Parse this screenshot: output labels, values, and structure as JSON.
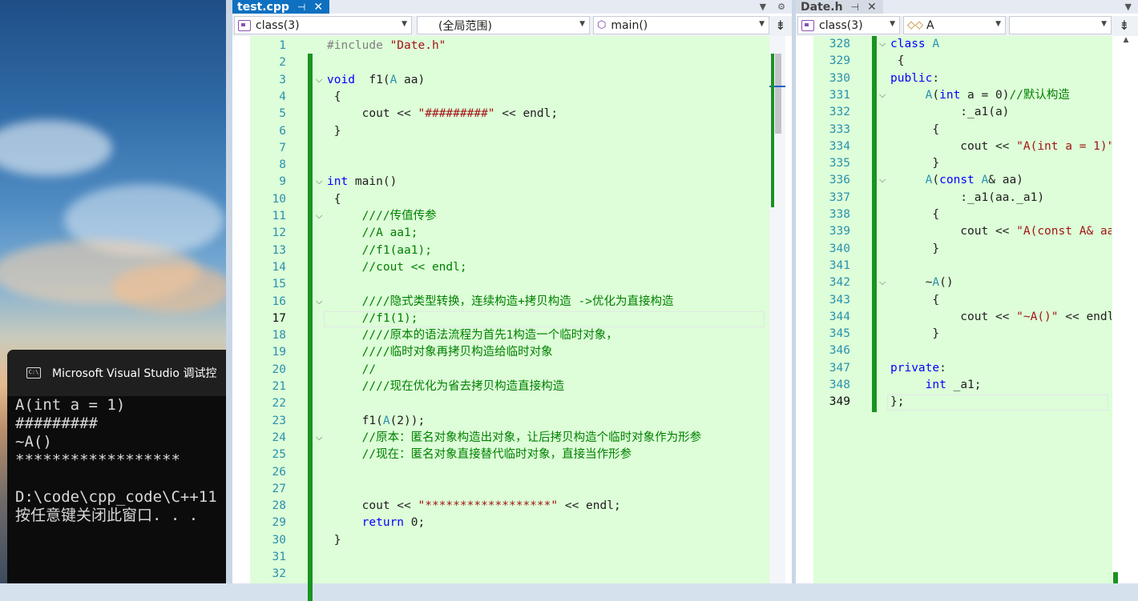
{
  "console": {
    "title": "Microsoft Visual Studio 调试控",
    "lines": [
      "A(int a = 1)",
      "#########",
      "~A()",
      "******************",
      "",
      "D:\\code\\cpp_code\\C++11",
      "按任意键关闭此窗口. . ."
    ]
  },
  "left_editor": {
    "tab": {
      "label": "test.cpp",
      "pin": "⊣",
      "close": "✕"
    },
    "nav": {
      "scope": "class(3)",
      "context": "(全局范围)",
      "member": "main()"
    },
    "lines": [
      {
        "n": "1",
        "t": [
          [
            "pp",
            "#include "
          ],
          [
            "st",
            "\"Date.h\""
          ]
        ]
      },
      {
        "n": "2",
        "t": []
      },
      {
        "n": "3",
        "t": [
          [
            "kw",
            "void"
          ],
          [
            "",
            "  "
          ],
          [
            "",
            "f1"
          ],
          [
            "",
            "("
          ],
          [
            "ty",
            "A"
          ],
          [
            "",
            " aa)"
          ]
        ]
      },
      {
        "n": "4",
        "t": [
          [
            "",
            " {"
          ]
        ]
      },
      {
        "n": "5",
        "t": [
          [
            "",
            "     cout << "
          ],
          [
            "st",
            "\"#########\""
          ],
          [
            "",
            " << endl;"
          ]
        ]
      },
      {
        "n": "6",
        "t": [
          [
            "",
            " }"
          ]
        ]
      },
      {
        "n": "7",
        "t": []
      },
      {
        "n": "8",
        "t": []
      },
      {
        "n": "9",
        "t": [
          [
            "kw",
            "int"
          ],
          [
            "",
            " main()"
          ]
        ]
      },
      {
        "n": "10",
        "t": [
          [
            "",
            " {"
          ]
        ]
      },
      {
        "n": "11",
        "t": [
          [
            "cm",
            "     ////传值传参"
          ]
        ]
      },
      {
        "n": "12",
        "t": [
          [
            "cm",
            "     //A aa1;"
          ]
        ]
      },
      {
        "n": "13",
        "t": [
          [
            "cm",
            "     //f1(aa1);"
          ]
        ]
      },
      {
        "n": "14",
        "t": [
          [
            "cm",
            "     //cout << endl;"
          ]
        ]
      },
      {
        "n": "15",
        "t": []
      },
      {
        "n": "16",
        "t": [
          [
            "cm",
            "     ////隐式类型转换，连续构造+拷贝构造 ->优化为直接构造"
          ]
        ]
      },
      {
        "n": "17",
        "t": [
          [
            "cm",
            "     //f1(1);"
          ]
        ]
      },
      {
        "n": "18",
        "t": [
          [
            "cm",
            "     ////原本的语法流程为首先1构造一个临时对象，"
          ]
        ]
      },
      {
        "n": "19",
        "t": [
          [
            "cm",
            "     ////临时对象再拷贝构造给临时对象"
          ]
        ]
      },
      {
        "n": "20",
        "t": [
          [
            "cm",
            "     //"
          ]
        ]
      },
      {
        "n": "21",
        "t": [
          [
            "cm",
            "     ////现在优化为省去拷贝构造直接构造"
          ]
        ]
      },
      {
        "n": "22",
        "t": []
      },
      {
        "n": "23",
        "t": [
          [
            "",
            "     f1("
          ],
          [
            "ty",
            "A"
          ],
          [
            "",
            "(2));"
          ]
        ]
      },
      {
        "n": "24",
        "t": [
          [
            "cm",
            "     //原本：匿名对象构造出对象，让后拷贝构造个临时对象作为形参"
          ]
        ]
      },
      {
        "n": "25",
        "t": [
          [
            "cm",
            "     //现在：匿名对象直接替代临时对象，直接当作形参"
          ]
        ]
      },
      {
        "n": "26",
        "t": []
      },
      {
        "n": "27",
        "t": []
      },
      {
        "n": "28",
        "t": [
          [
            "",
            "     cout << "
          ],
          [
            "st",
            "\"******************\""
          ],
          [
            "",
            " << endl;"
          ]
        ]
      },
      {
        "n": "29",
        "t": [
          [
            "",
            "     "
          ],
          [
            "kw",
            "return"
          ],
          [
            "",
            " 0;"
          ]
        ]
      },
      {
        "n": "30",
        "t": [
          [
            "",
            " }"
          ]
        ]
      },
      {
        "n": "31",
        "t": []
      },
      {
        "n": "32",
        "t": []
      }
    ],
    "current_line": "17"
  },
  "right_editor": {
    "tab": {
      "label": "Date.h",
      "pin": "⊣",
      "close": "✕"
    },
    "nav": {
      "scope": "class(3)",
      "member": "A"
    },
    "lines": [
      {
        "n": "328",
        "t": [
          [
            "kw",
            "class"
          ],
          [
            "",
            " "
          ],
          [
            "ty",
            "A"
          ]
        ]
      },
      {
        "n": "329",
        "t": [
          [
            "",
            " {"
          ]
        ]
      },
      {
        "n": "330",
        "t": [
          [
            "kw",
            "public"
          ],
          [
            "",
            ":"
          ]
        ]
      },
      {
        "n": "331",
        "t": [
          [
            "",
            "     "
          ],
          [
            "ty",
            "A"
          ],
          [
            "",
            "("
          ],
          [
            "kw",
            "int"
          ],
          [
            "",
            " a = 0)"
          ],
          [
            "cm",
            "//默认构造"
          ]
        ]
      },
      {
        "n": "332",
        "t": [
          [
            "",
            "          :_a1(a)"
          ]
        ]
      },
      {
        "n": "333",
        "t": [
          [
            "",
            "      {"
          ]
        ]
      },
      {
        "n": "334",
        "t": [
          [
            "",
            "          cout << "
          ],
          [
            "st",
            "\"A(int a = 1)\""
          ],
          [
            "",
            " <"
          ]
        ]
      },
      {
        "n": "335",
        "t": [
          [
            "",
            "      }"
          ]
        ]
      },
      {
        "n": "336",
        "t": [
          [
            "",
            "     "
          ],
          [
            "ty",
            "A"
          ],
          [
            "",
            "("
          ],
          [
            "kw",
            "const"
          ],
          [
            "",
            " "
          ],
          [
            "ty",
            "A"
          ],
          [
            "",
            "& aa)"
          ]
        ]
      },
      {
        "n": "337",
        "t": [
          [
            "",
            "          :_a1(aa._a1)"
          ]
        ]
      },
      {
        "n": "338",
        "t": [
          [
            "",
            "      {"
          ]
        ]
      },
      {
        "n": "339",
        "t": [
          [
            "",
            "          cout << "
          ],
          [
            "st",
            "\"A(const A& aa)\""
          ]
        ]
      },
      {
        "n": "340",
        "t": [
          [
            "",
            "      }"
          ]
        ]
      },
      {
        "n": "341",
        "t": []
      },
      {
        "n": "342",
        "t": [
          [
            "",
            "     ~"
          ],
          [
            "ty",
            "A"
          ],
          [
            "",
            "()"
          ]
        ]
      },
      {
        "n": "343",
        "t": [
          [
            "",
            "      {"
          ]
        ]
      },
      {
        "n": "344",
        "t": [
          [
            "",
            "          cout << "
          ],
          [
            "st",
            "\"~A()\""
          ],
          [
            "",
            " << endl;"
          ]
        ]
      },
      {
        "n": "345",
        "t": [
          [
            "",
            "      }"
          ]
        ]
      },
      {
        "n": "346",
        "t": []
      },
      {
        "n": "347",
        "t": [
          [
            "kw",
            "private"
          ],
          [
            "",
            ":"
          ]
        ]
      },
      {
        "n": "348",
        "t": [
          [
            "",
            "     "
          ],
          [
            "kw",
            "int"
          ],
          [
            "",
            " _a1;"
          ]
        ]
      },
      {
        "n": "349",
        "t": [
          [
            "",
            "};"
          ]
        ]
      }
    ],
    "current_line": "349"
  },
  "colors": {
    "code_bg": "#ddfed8",
    "keyword": "#0000ff",
    "comment": "#008000",
    "string": "#a31515",
    "type": "#2b91af",
    "accent": "#0e70c0"
  }
}
